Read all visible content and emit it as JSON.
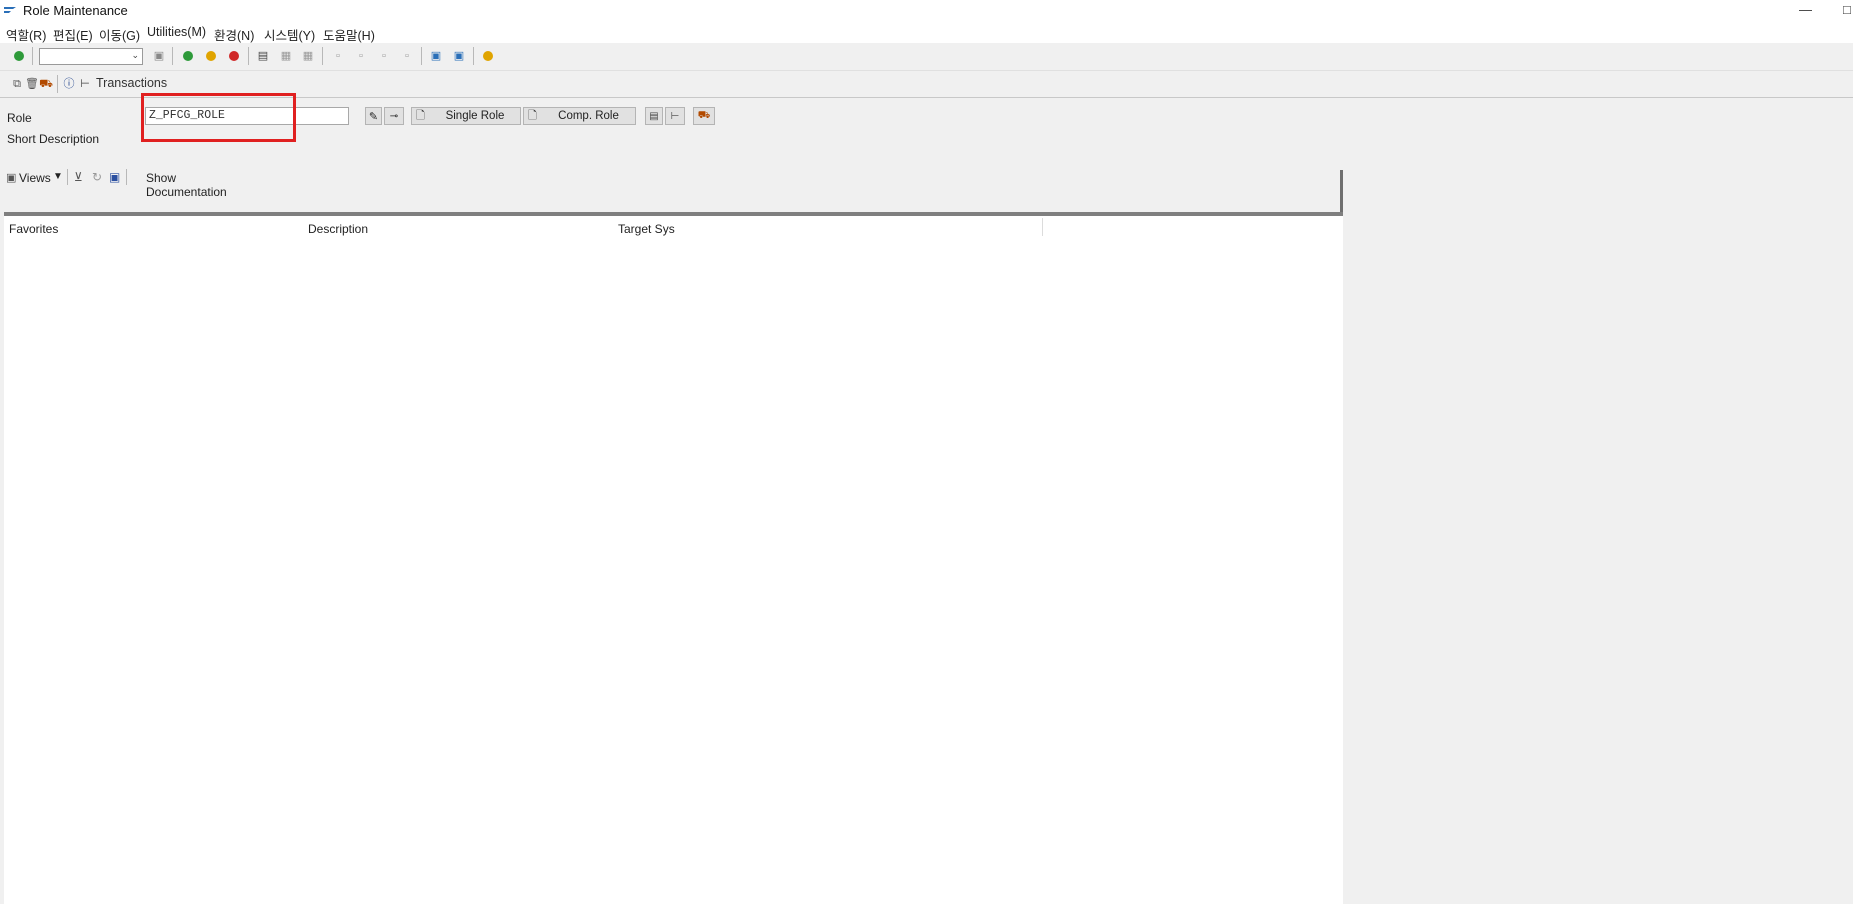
{
  "window": {
    "title": "Role Maintenance",
    "minimize_glyph": "—",
    "maximize_glyph": "□"
  },
  "menu": [
    "역할(R)",
    "편집(E)",
    "이동(G)",
    "Utilities(M)",
    "환경(N)",
    "시스템(Y)",
    "도움말(H)"
  ],
  "toolbar": {
    "transactions_label": "Transactions"
  },
  "form": {
    "role_label": "Role",
    "role_value": "Z_PFCG_ROLE",
    "short_description_label": "Short Description",
    "single_role_button": "Single Role",
    "comp_role_button": "Comp. Role"
  },
  "views_bar": {
    "views_label": "Views",
    "show_documentation": "Show Documentation"
  },
  "table": {
    "columns": [
      "Favorites",
      "Description",
      "Target Sys"
    ]
  },
  "colors": {
    "highlight": "#e02020",
    "background": "#f0f0f0"
  }
}
